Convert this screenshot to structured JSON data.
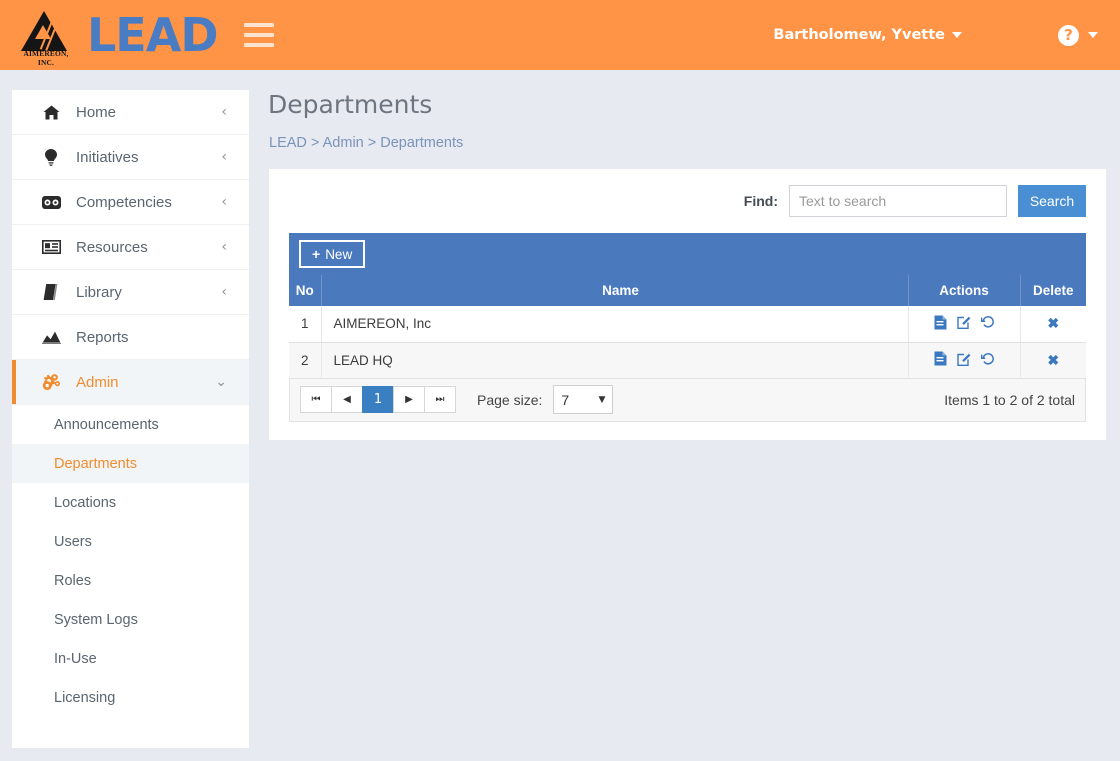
{
  "header": {
    "logo_text": "LEAD",
    "logo_sub": "AIMEREON, INC.",
    "menu_icon": "hamburger-icon",
    "user_name": "Bartholomew, Yvette",
    "help_glyph": "?"
  },
  "sidebar": {
    "items": [
      {
        "label": "Home",
        "icon": "home-icon",
        "chevron": "‹",
        "active": false
      },
      {
        "label": "Initiatives",
        "icon": "lightbulb-icon",
        "chevron": "‹",
        "active": false
      },
      {
        "label": "Competencies",
        "icon": "dashboard-icon",
        "chevron": "‹",
        "active": false
      },
      {
        "label": "Resources",
        "icon": "id-card-icon",
        "chevron": "‹",
        "active": false
      },
      {
        "label": "Library",
        "icon": "book-icon",
        "chevron": "‹",
        "active": false
      },
      {
        "label": "Reports",
        "icon": "chart-area-icon",
        "chevron": "",
        "active": false
      },
      {
        "label": "Admin",
        "icon": "gears-icon",
        "chevron": "⌄",
        "active": true
      }
    ],
    "sub_items": [
      {
        "label": "Announcements",
        "active": false
      },
      {
        "label": "Departments",
        "active": true
      },
      {
        "label": "Locations",
        "active": false
      },
      {
        "label": "Users",
        "active": false
      },
      {
        "label": "Roles",
        "active": false
      },
      {
        "label": "System Logs",
        "active": false
      },
      {
        "label": "In-Use",
        "active": false
      },
      {
        "label": "Licensing",
        "active": false
      }
    ]
  },
  "main": {
    "page_title": "Departments",
    "breadcrumb": [
      {
        "text": "LEAD",
        "link": true
      },
      {
        "text": ">",
        "link": false
      },
      {
        "text": "Admin",
        "link": true
      },
      {
        "text": ">",
        "link": false
      },
      {
        "text": "Departments",
        "link": true
      }
    ],
    "find": {
      "label": "Find:",
      "placeholder": "Text to search",
      "value": "",
      "search_button": "Search"
    },
    "toolbar": {
      "new_label": "New",
      "new_plus": "+"
    },
    "table": {
      "columns": [
        "No",
        "Name",
        "Actions",
        "Delete"
      ],
      "rows": [
        {
          "no": "1",
          "name": "AIMEREON, Inc"
        },
        {
          "no": "2",
          "name": "LEAD HQ"
        }
      ],
      "action_icons": [
        "report-icon",
        "edit-icon",
        "history-icon"
      ],
      "delete_glyph": "✖"
    },
    "pager": {
      "first": "⏮",
      "prev": "◀",
      "current_page": "1",
      "next": "▶",
      "last": "⏭",
      "page_size_label": "Page size:",
      "page_size_value": "7",
      "page_size_caret": "▼",
      "items_summary": "Items 1 to 2 of 2 total"
    }
  },
  "colors": {
    "header_orange": "#ff9446",
    "accent_orange": "#f08c2e",
    "grid_blue": "#4a79bd",
    "button_blue": "#4a8fd4",
    "page_bg": "#e8eaf2"
  }
}
